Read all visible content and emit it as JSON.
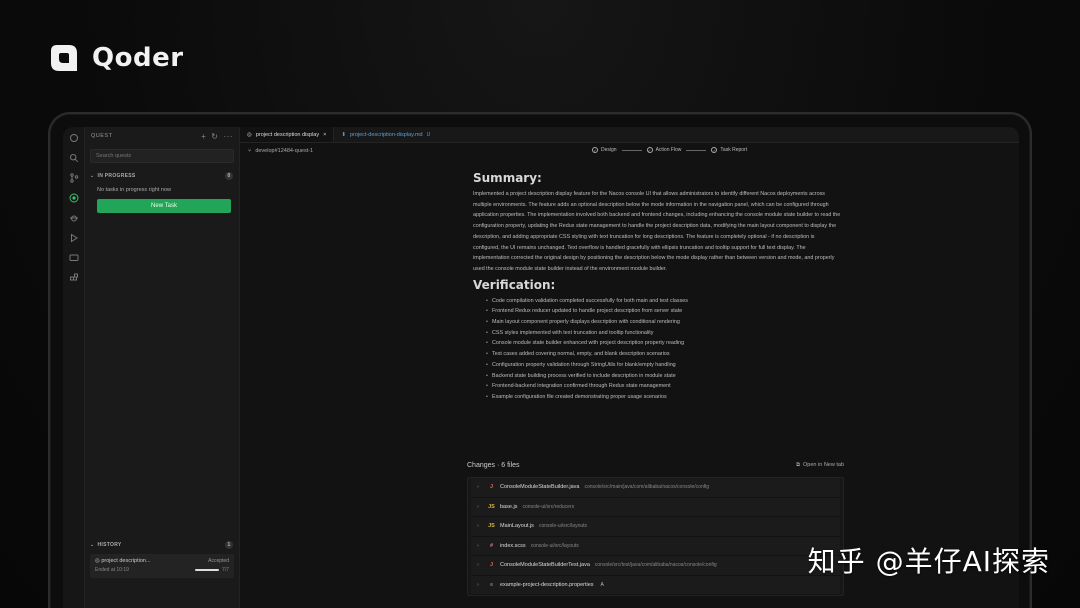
{
  "brand": {
    "name": "Qoder",
    "accent": "#ffffff"
  },
  "sidebar": {
    "header": "QUEST",
    "search_placeholder": "Search quests",
    "in_progress": {
      "label": "IN PROGRESS",
      "count": "0",
      "empty": "No tasks in progress right now"
    },
    "new_task_label": "New Task",
    "history": {
      "label": "HISTORY",
      "count": "1",
      "items": [
        {
          "title": "project description...",
          "status": "Accepted",
          "time": "Ended at 10:19",
          "progress_text": "7/7",
          "progress": 1.0
        }
      ]
    }
  },
  "tabs": [
    {
      "label": "project description display",
      "active": true
    },
    {
      "label": "project-description-display.md",
      "badge": "U",
      "active": false
    }
  ],
  "branch": "develop#12484-quest-1",
  "steps": [
    {
      "label": "Design"
    },
    {
      "label": "Action Flow"
    },
    {
      "label": "Task Report"
    }
  ],
  "report": {
    "summary_title": "Summary:",
    "summary_text": "Implemented a project description display feature for the Nacos console UI that allows administrators to identify different Nacos deployments across multiple environments. The feature adds an optional description below the mode information in the navigation panel, which can be configured through application properties. The implementation involved both backend and frontend changes, including enhancing the console module state builder to read the configuration property, updating the Redux state management to handle the project description data, modifying the main layout component to display the description, and adding appropriate CSS styling with text truncation for long descriptions. The feature is completely optional - if no description is configured, the UI remains unchanged. Text overflow is handled gracefully with ellipsis truncation and tooltip support for full text display. The implementation corrected the original design by positioning the description below the mode display rather than between version and mode, and properly used the console module state builder instead of the environment module builder.",
    "verification_title": "Verification:",
    "verification_items": [
      "Code compilation validation completed successfully for both main and test classes",
      "Frontend Redux reducer updated to handle project description from server state",
      "Main layout component properly displays description with conditional rendering",
      "CSS styles implemented with text truncation and tooltip functionality",
      "Console module state builder enhanced with project description property reading",
      "Test cases added covering normal, empty, and blank description scenarios",
      "Configuration property validation through StringUtils for blank/empty handling",
      "Backend state building process verified to include description in module state",
      "Frontend-backend integration confirmed through Redux state management",
      "Example configuration file created demonstrating proper usage scenarios"
    ]
  },
  "changes": {
    "title": "Changes · 6 files",
    "open_label": "Open in New tab",
    "files": [
      {
        "icon": "java",
        "glyph": "J",
        "name": "ConsoleModuleStateBuilder.java",
        "path": "console/src/main/java/com/alibaba/nacos/console/config",
        "badge": ""
      },
      {
        "icon": "js",
        "glyph": "JS",
        "name": "base.js",
        "path": "console-ui/src/reducers",
        "badge": ""
      },
      {
        "icon": "js",
        "glyph": "JS",
        "name": "MainLayout.js",
        "path": "console-ui/src/layouts",
        "badge": ""
      },
      {
        "icon": "scss",
        "glyph": "#",
        "name": "index.scss",
        "path": "console-ui/src/layouts",
        "badge": ""
      },
      {
        "icon": "java",
        "glyph": "J",
        "name": "ConsoleModuleStateBuilderTest.java",
        "path": "console/src/test/java/com/alibaba/nacos/console/config",
        "badge": ""
      },
      {
        "icon": "props",
        "glyph": "≡",
        "name": "example-project-description.properties",
        "path": "",
        "badge": "A"
      }
    ]
  },
  "watermark": "知乎 @羊仔AI探索"
}
